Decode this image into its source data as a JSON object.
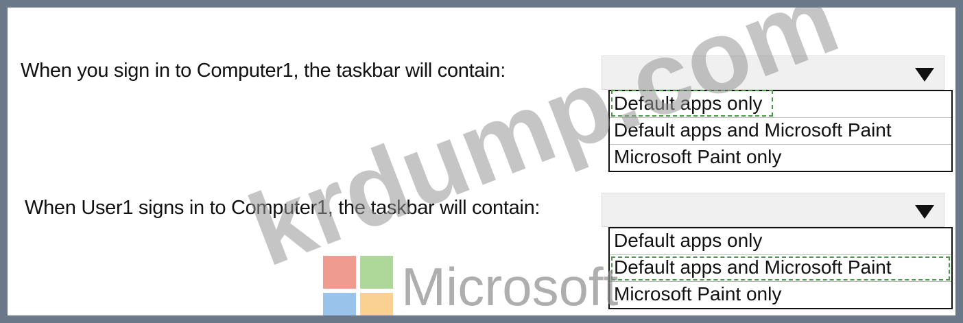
{
  "questions": [
    {
      "label": "When you sign in to Computer1, the taskbar will contain:",
      "options": [
        "Default apps only",
        "Default apps and Microsoft Paint",
        "Microsoft Paint only"
      ],
      "selected": "Default apps only"
    },
    {
      "label": "When User1 signs in to Computer1, the taskbar will contain:",
      "options": [
        "Default apps only",
        "Default apps and Microsoft Paint",
        "Microsoft Paint only"
      ],
      "selected": "Default apps and Microsoft Paint"
    }
  ],
  "watermark": {
    "text": "krdump.com",
    "logo_text": "Microsoft"
  },
  "colors": {
    "frame": "#6b7889",
    "selection_outline": "#4a9a4a",
    "dropdown_header": "#f0f0f0"
  },
  "icons": {
    "dropdown": "triangle-down-icon",
    "logo": "microsoft-logo"
  }
}
